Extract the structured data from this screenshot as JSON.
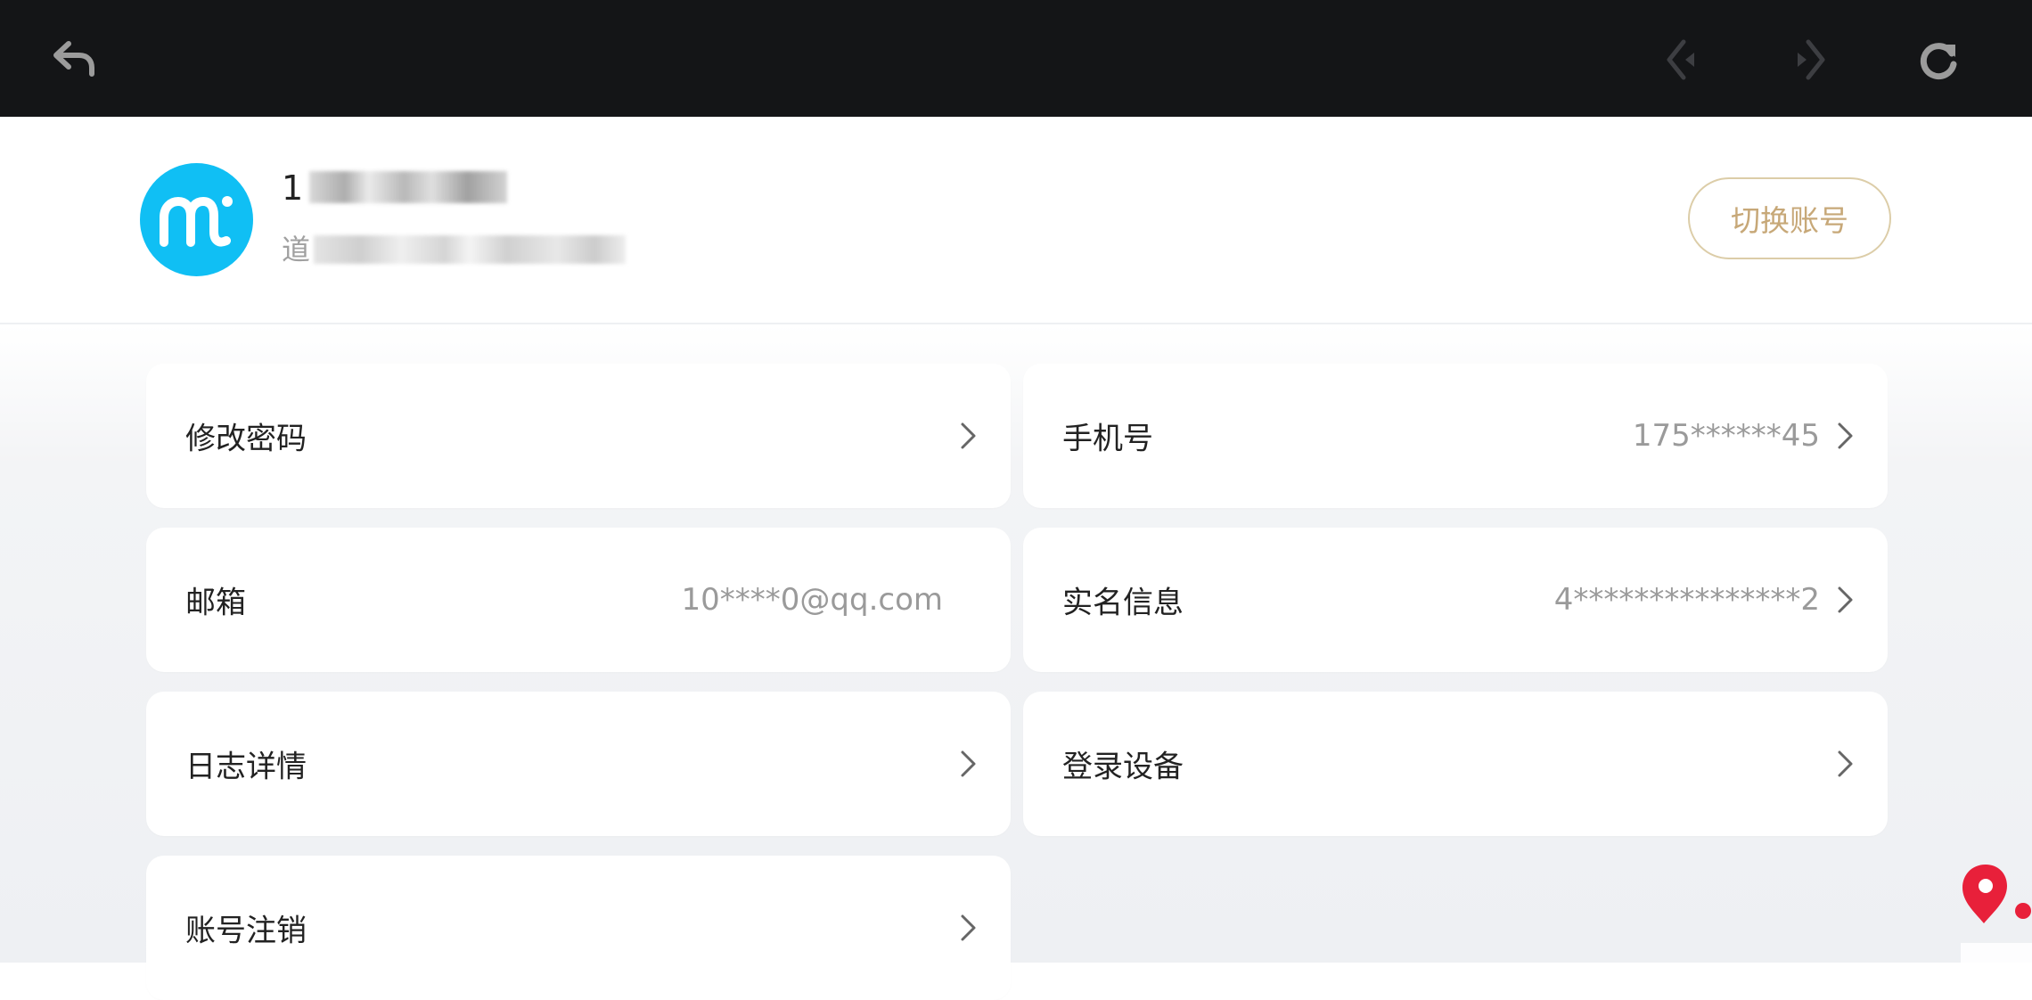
{
  "topbar": {
    "back_icon": "back-arrow-icon",
    "nav_back_icon": "nav-back-icon",
    "nav_forward_icon": "nav-forward-icon",
    "refresh_icon": "refresh-icon"
  },
  "profile": {
    "avatar_text": "mi",
    "username_prefix": "1",
    "subline_prefix": "道",
    "switch_account_label": "切换账号"
  },
  "menu": {
    "change_password": {
      "label": "修改密码",
      "value": ""
    },
    "phone": {
      "label": "手机号",
      "value": "175******45"
    },
    "email": {
      "label": "邮箱",
      "value": "10****0@qq.com"
    },
    "real_name": {
      "label": "实名信息",
      "value": "4***************2"
    },
    "log_details": {
      "label": "日志详情",
      "value": ""
    },
    "login_devices": {
      "label": "登录设备",
      "value": ""
    },
    "account_cancel": {
      "label": "账号注销",
      "value": ""
    }
  },
  "colors": {
    "topbar_bg": "#141517",
    "avatar_bg": "#10bff4",
    "switch_accent": "#c7a878",
    "watermark_red": "#e8203a"
  }
}
